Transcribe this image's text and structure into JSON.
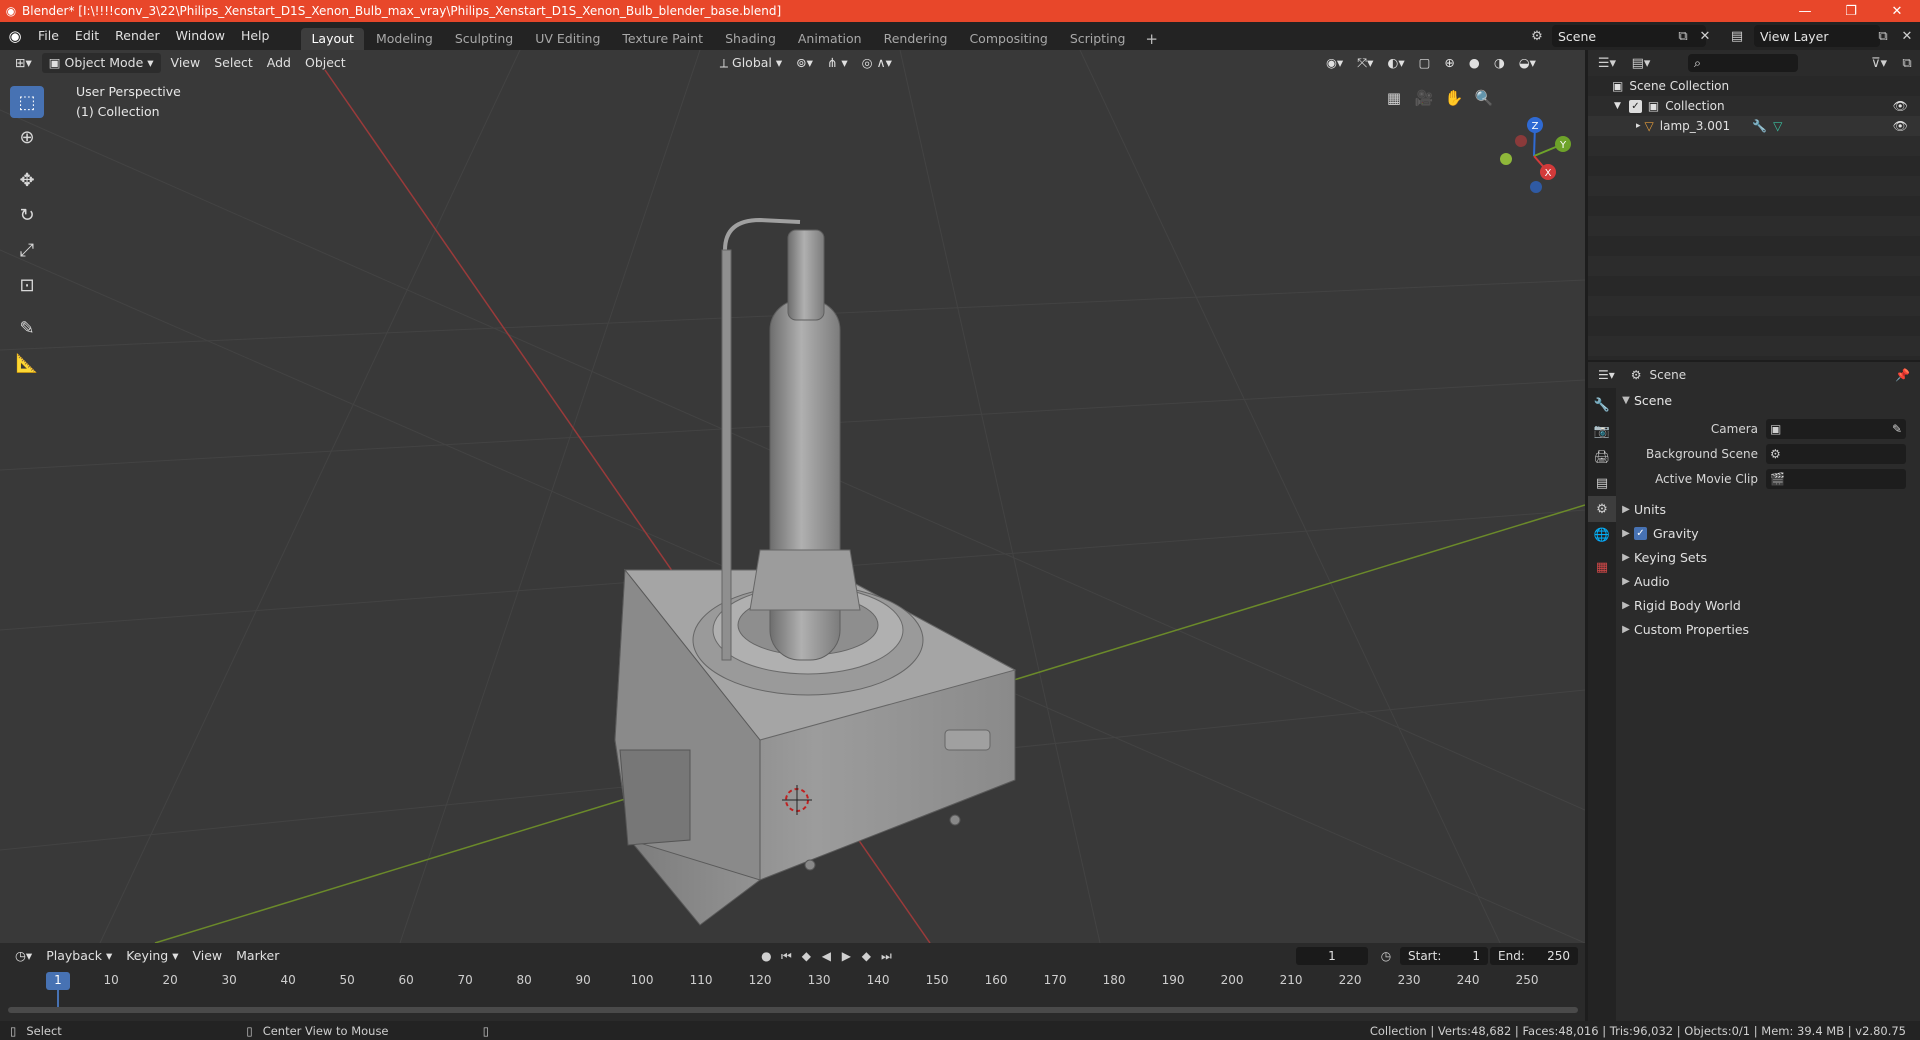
{
  "window": {
    "title": "Blender* [I:\\!!!!conv_3\\22\\Philips_Xenstart_D1S_Xenon_Bulb_max_vray\\Philips_Xenstart_D1S_Xenon_Bulb_blender_base.blend]",
    "minimize": "—",
    "maximize": "❐",
    "close": "✕"
  },
  "menu": [
    "File",
    "Edit",
    "Render",
    "Window",
    "Help"
  ],
  "workspaces": [
    "Layout",
    "Modeling",
    "Sculpting",
    "UV Editing",
    "Texture Paint",
    "Shading",
    "Animation",
    "Rendering",
    "Compositing",
    "Scripting"
  ],
  "active_workspace": "Layout",
  "scene_name": "Scene",
  "view_layer": "View Layer",
  "viewport": {
    "mode": "Object Mode",
    "menus": [
      "View",
      "Select",
      "Add",
      "Object"
    ],
    "transform_orientation": "Global",
    "perspective_label": "User Perspective",
    "collection_label": "(1) Collection",
    "gizmo": {
      "x": "X",
      "y": "Y",
      "z": "Z"
    }
  },
  "timeline": {
    "menus": [
      "Playback",
      "Keying",
      "View",
      "Marker"
    ],
    "current_frame": "1",
    "start_label": "Start:",
    "start": "1",
    "end_label": "End:",
    "end": "250",
    "ruler": [
      "1",
      "10",
      "20",
      "30",
      "40",
      "50",
      "60",
      "70",
      "80",
      "90",
      "100",
      "110",
      "120",
      "130",
      "140",
      "150",
      "160",
      "170",
      "180",
      "190",
      "200",
      "210",
      "220",
      "230",
      "240",
      "250"
    ]
  },
  "statusbar": {
    "select": "Select",
    "center_view": "Center View to Mouse",
    "stats": "Collection | Verts:48,682 | Faces:48,016 | Tris:96,032 | Objects:0/1 | Mem: 39.4 MB | v2.80.75"
  },
  "outliner": {
    "root": "Scene Collection",
    "collection": "Collection",
    "object": "lamp_3.001"
  },
  "properties": {
    "context": "Scene",
    "panel": "Scene",
    "fields": [
      {
        "label": "Camera",
        "value": ""
      },
      {
        "label": "Background Scene",
        "value": ""
      },
      {
        "label": "Active Movie Clip",
        "value": ""
      }
    ],
    "subpanels": [
      "Units",
      "Gravity",
      "Keying Sets",
      "Audio",
      "Rigid Body World",
      "Custom Properties"
    ]
  }
}
